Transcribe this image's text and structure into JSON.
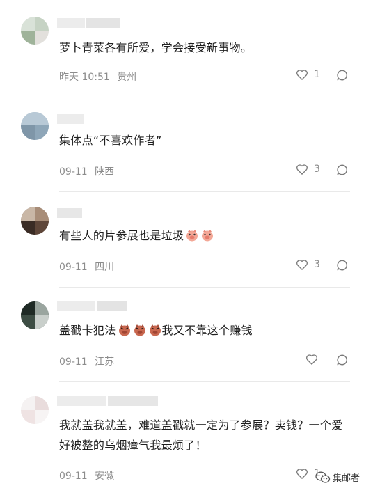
{
  "comments": [
    {
      "text": "萝卜青菜各有所爱，学会接受新事物。",
      "date": "昨天 10:51",
      "location": "贵州",
      "likes": "1",
      "emojis": []
    },
    {
      "text": "集体点“不喜欢作者”",
      "date": "09-11",
      "location": "陕西",
      "likes": "3",
      "emojis": []
    },
    {
      "text": "有些人的片参展也是垃圾",
      "date": "09-11",
      "location": "四川",
      "likes": "3",
      "emojis": [
        "pig-face-emoji",
        "pig-face-emoji"
      ]
    },
    {
      "text_before": "盖戳卡犯法",
      "text_after": "我又不靠这个赚钱",
      "date": "09-11",
      "location": "江苏",
      "likes": "",
      "emojis": [
        "angry-pig-emoji",
        "angry-pig-emoji",
        "angry-pig-emoji"
      ]
    },
    {
      "text": "我就盖我就盖，难道盖戳就一定为了参展？卖钱？一个爱好被整的乌烟瘴气我最烦了！",
      "date": "09-11",
      "location": "安徽",
      "likes": "1",
      "emojis": []
    }
  ],
  "icons": {
    "like": "heart-outline-icon",
    "reply": "chat-bubble-icon",
    "watermark": "wechat-logo-icon"
  },
  "watermark_text": "集邮者",
  "colors": {
    "meta": "#8c8c8c",
    "divider": "#e9e9e9",
    "text": "#1f1f1f"
  }
}
